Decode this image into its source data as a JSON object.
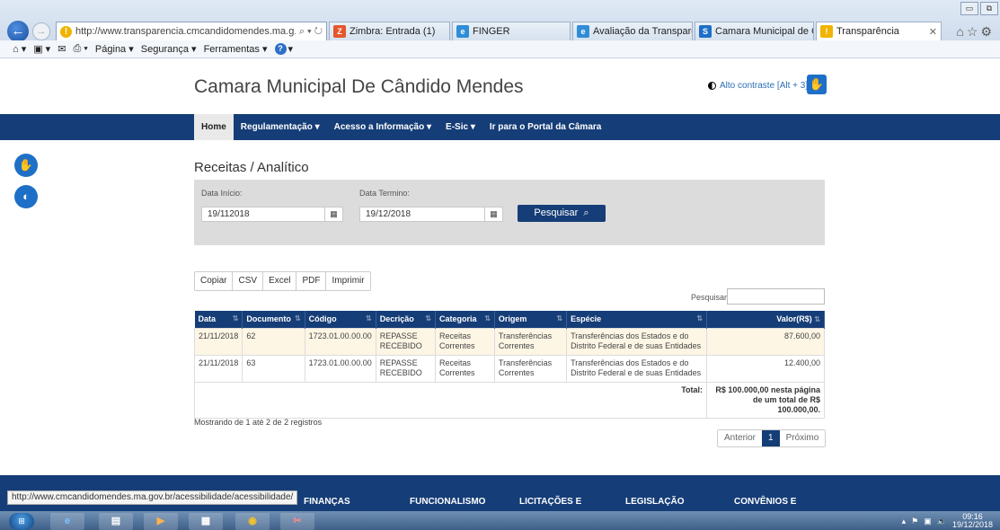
{
  "browser": {
    "address_url": "http://www.transparencia.cmcandidomendes.ma.g...",
    "address_controls": "⌕ ▾ ↻",
    "tabs": [
      {
        "label": "Zimbra: Entrada (1)",
        "icon_color": "#e4562c",
        "active": false
      },
      {
        "label": "FINGER",
        "icon_color": "#2f8dd8",
        "active": false
      },
      {
        "label": "Avaliação da Transparê...",
        "icon_color": "#2f8dd8",
        "active": false
      },
      {
        "label": "Camara Municipal de C...",
        "icon_color": "#1e6fc8",
        "active": false
      },
      {
        "label": "Transparência",
        "icon_color": "#f0b400",
        "active": true
      }
    ],
    "commands": [
      "Página ▾",
      "Segurança ▾",
      "Ferramentas ▾"
    ],
    "status_url": "http://www.cmcandidomendes.ma.gov.br/acessibilidade/acessibilidade/"
  },
  "site": {
    "title": "Camara Municipal De Cândido Mendes",
    "contrast_label": "Alto contraste [Alt + 3]"
  },
  "nav": {
    "items": [
      "Home",
      "Regulamentação ▾",
      "Acesso a Informação ▾",
      "E-Sic ▾",
      "Ir para o Portal da Câmara"
    ]
  },
  "page": {
    "heading": "Receitas / Analítico",
    "filters": {
      "start_label": "Data Início:",
      "start_value": "19/112018",
      "end_label": "Data Termino:",
      "end_value": "19/12/2018",
      "search_button": "Pesquisar"
    },
    "export_buttons": [
      "Copiar",
      "CSV",
      "Excel",
      "PDF",
      "Imprimir"
    ],
    "search_label": "Pesquisar",
    "table": {
      "columns": [
        "Data",
        "Documento",
        "Código",
        "Decrição",
        "Categoria",
        "Origem",
        "Espécie",
        "Valor(R$)"
      ],
      "rows": [
        [
          "21/11/2018",
          "62",
          "1723.01.00.00.00",
          "REPASSE RECEBIDO",
          "Receitas Correntes",
          "Transferências Correntes",
          "Transferências dos Estados e do Distrito Federal e de suas Entidades",
          "87.600,00"
        ],
        [
          "21/11/2018",
          "63",
          "1723.01.00.00.00",
          "REPASSE RECEBIDO",
          "Receitas Correntes",
          "Transferências Correntes",
          "Transferências dos Estados e do Distrito Federal e de suas Entidades",
          "12.400,00"
        ]
      ],
      "total_label": "Total:",
      "total_value": "R$ 100.000,00 nesta página de um total de R$ 100.000,00."
    },
    "info": "Mostrando de 1 até 2 de 2 registros",
    "pager": {
      "prev": "Anterior",
      "current": "1",
      "next": "Próximo"
    }
  },
  "footer": {
    "columns": [
      "FINANÇAS",
      "FUNCIONALISMO",
      "LICITAÇÕES E",
      "LEGISLAÇÃO",
      "CONVÊNIOS E"
    ]
  },
  "taskbar": {
    "time": "09:16",
    "date": "19/12/2018"
  }
}
